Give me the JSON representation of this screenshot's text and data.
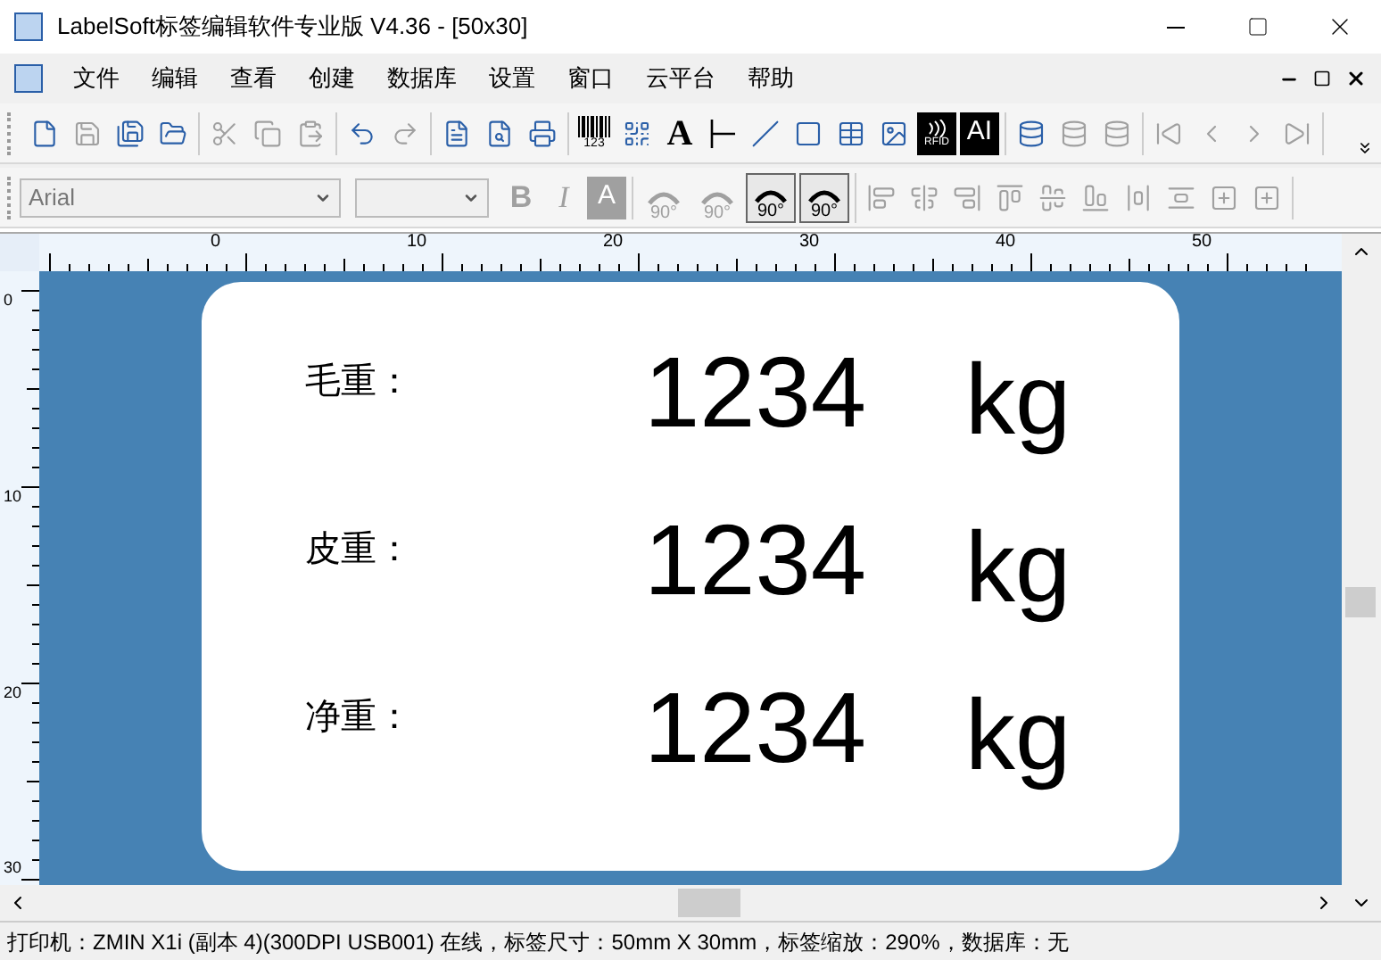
{
  "window": {
    "title": "LabelSoft标签编辑软件专业版 V4.36 - [50x30]"
  },
  "menu": [
    "文件",
    "编辑",
    "查看",
    "创建",
    "数据库",
    "设置",
    "窗口",
    "云平台",
    "帮助"
  ],
  "toolbar_1": [
    [
      {
        "kind": "new",
        "disabled": false
      },
      {
        "kind": "save",
        "disabled": true
      },
      {
        "kind": "save-all",
        "disabled": false
      },
      {
        "kind": "open",
        "disabled": false
      }
    ],
    [
      {
        "kind": "cut",
        "disabled": true
      },
      {
        "kind": "copy",
        "disabled": true
      },
      {
        "kind": "paste",
        "disabled": true
      }
    ],
    [
      {
        "kind": "undo",
        "disabled": false
      },
      {
        "kind": "redo",
        "disabled": true
      }
    ],
    [
      {
        "kind": "page",
        "disabled": false
      },
      {
        "kind": "preview",
        "disabled": false
      },
      {
        "kind": "print",
        "disabled": false
      }
    ],
    [
      {
        "kind": "barcode",
        "label": "123",
        "disabled": false
      },
      {
        "kind": "qrcode",
        "disabled": false
      },
      {
        "kind": "text",
        "label": "A",
        "disabled": false
      },
      {
        "kind": "vline",
        "disabled": false
      },
      {
        "kind": "line",
        "disabled": false
      },
      {
        "kind": "rect",
        "disabled": false
      },
      {
        "kind": "table",
        "disabled": false
      },
      {
        "kind": "image",
        "disabled": false
      },
      {
        "kind": "rfid",
        "label": "RFID",
        "disabled": false
      },
      {
        "kind": "ai",
        "label": "AI",
        "disabled": false
      }
    ],
    [
      {
        "kind": "database",
        "disabled": false
      },
      {
        "kind": "database",
        "disabled": true
      },
      {
        "kind": "database",
        "disabled": true
      }
    ],
    [
      {
        "kind": "first",
        "disabled": true
      },
      {
        "kind": "prev",
        "disabled": true
      },
      {
        "kind": "next",
        "disabled": true
      },
      {
        "kind": "last",
        "disabled": true
      }
    ]
  ],
  "font_select": {
    "value": "Arial"
  },
  "toolbar_2": [
    [
      {
        "kind": "bold",
        "label": "B",
        "disabled": true
      },
      {
        "kind": "italic",
        "label": "I",
        "disabled": true
      },
      {
        "kind": "shade",
        "label": "A",
        "disabled": true
      }
    ],
    [
      {
        "kind": "rotate",
        "label": "90°",
        "disabled": true
      },
      {
        "kind": "rotate",
        "label": "90°",
        "disabled": true
      },
      {
        "kind": "rotate",
        "label": "90°",
        "disabled": false
      },
      {
        "kind": "rotate",
        "label": "90°",
        "disabled": false
      }
    ],
    [
      {
        "kind": "align-left",
        "disabled": true
      },
      {
        "kind": "align-center",
        "disabled": true
      },
      {
        "kind": "align-right",
        "disabled": true
      },
      {
        "kind": "align-top",
        "disabled": true
      },
      {
        "kind": "align-middle",
        "disabled": true
      },
      {
        "kind": "align-bottom",
        "disabled": true
      },
      {
        "kind": "space-h",
        "disabled": true
      },
      {
        "kind": "space-v",
        "disabled": true
      },
      {
        "kind": "center-h",
        "disabled": true
      },
      {
        "kind": "center-v",
        "disabled": true
      }
    ]
  ],
  "ruler_h": [
    "0",
    "10",
    "20",
    "30",
    "40",
    "50"
  ],
  "ruler_v": [
    "0",
    "10",
    "20",
    "30"
  ],
  "label": {
    "rows": [
      {
        "name": "毛重：",
        "value": "1234",
        "unit": "kg"
      },
      {
        "name": "皮重：",
        "value": "1234",
        "unit": "kg"
      },
      {
        "name": "净重：",
        "value": "1234",
        "unit": "kg"
      }
    ]
  },
  "status_bar": "打印机：ZMIN X1i (副本 4)(300DPI USB001) 在线，标签尺寸：50mm X 30mm，标签缩放：290%，数据库：无"
}
